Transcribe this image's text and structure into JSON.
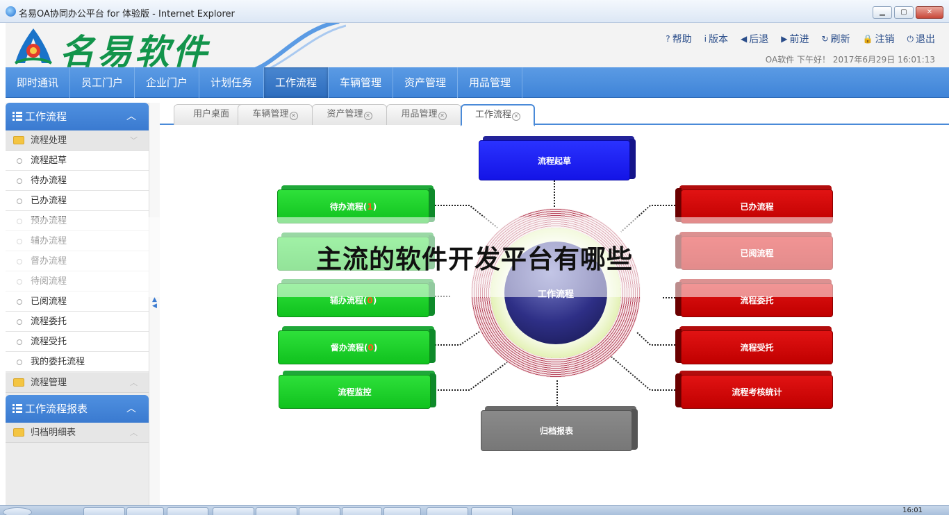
{
  "window": {
    "title": "名易OA协同办公平台 for 体验版 - Internet Explorer",
    "buttons": {
      "minimize": "▁",
      "maximize": "▢",
      "close": "✕"
    }
  },
  "header": {
    "logo_text": "名易软件",
    "links": [
      {
        "icon": "?",
        "label": "帮助"
      },
      {
        "icon": "i",
        "label": "版本"
      },
      {
        "icon": "◀",
        "label": "后退"
      },
      {
        "icon": "▶",
        "label": "前进"
      },
      {
        "icon": "↻",
        "label": "刷新"
      },
      {
        "icon": "🔒",
        "label": "注销"
      },
      {
        "icon": "⏻",
        "label": "退出"
      }
    ],
    "greeting": "OA软件 下午好！ 2017年6月29日 16:01:13"
  },
  "nav": {
    "items": [
      "即时通讯",
      "员工门户",
      "企业门户",
      "计划任务",
      "工作流程",
      "车辆管理",
      "资产管理",
      "用品管理"
    ],
    "active": "工作流程"
  },
  "sidebar": {
    "panel1": {
      "title": "工作流程",
      "group": "流程处理",
      "items": [
        "流程起草",
        "待办流程",
        "已办流程",
        "预办流程",
        "辅办流程",
        "督办流程",
        "待阅流程",
        "已阅流程",
        "流程委托",
        "流程受托",
        "我的委托流程"
      ],
      "group2": "流程管理"
    },
    "panel2": {
      "title": "工作流程报表",
      "group": "归档明细表"
    }
  },
  "tabs": [
    {
      "label": "用户桌面",
      "closable": false
    },
    {
      "label": "车辆管理",
      "closable": true
    },
    {
      "label": "资产管理",
      "closable": true
    },
    {
      "label": "用品管理",
      "closable": true
    },
    {
      "label": "工作流程",
      "closable": true,
      "active": true
    }
  ],
  "diagram": {
    "center": "工作流程",
    "top": "流程起草",
    "bottom": "归档报表",
    "left": [
      {
        "label": "待办流程(",
        "count": "1",
        "suffix": ")"
      },
      {
        "label": "",
        "count": "",
        "suffix": ""
      },
      {
        "label": "辅办流程(",
        "count": "0",
        "suffix": ")"
      },
      {
        "label": "督办流程(",
        "count": "0",
        "suffix": ")"
      },
      {
        "label": "流程监控",
        "count": "",
        "suffix": ""
      }
    ],
    "right": [
      "已办流程",
      "已阅流程",
      "流程委托",
      "流程受托",
      "流程考核统计"
    ]
  },
  "overlay": {
    "text": "主流的软件开发平台有哪些"
  },
  "taskbar": {
    "clock": "16:01"
  },
  "colors": {
    "nav_blue": "#3f84d8",
    "logo_green": "#12944b",
    "flow_green": "#10c21e",
    "flow_red": "#c00000",
    "flow_blue": "#1414e6",
    "flow_gray": "#777777"
  }
}
